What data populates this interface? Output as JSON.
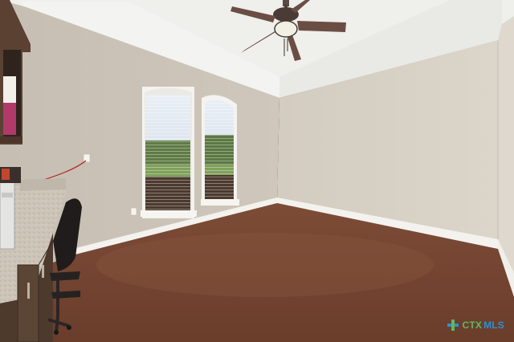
{
  "watermark": {
    "brand_main": "CTX",
    "brand_suffix": "MLS"
  },
  "colors": {
    "ceiling": "#f2f2ef",
    "wall_left": "#cbc3b7",
    "wall_back": "#d6cfc3",
    "wall_right": "#dcd6cb",
    "floor": "#7a4a35",
    "baseboard": "#f4f2ee",
    "countertop": "#c9c1b4",
    "cabinet": "#4e3a2d",
    "fan_blade": "#6a4e44",
    "logo_green": "#5cb85c",
    "logo_blue": "#2f8fcf",
    "logo_orange": "#f0a020"
  },
  "icons": [
    "ceiling-fan-icon",
    "office-chair-icon",
    "electrical-outlet-icon"
  ]
}
